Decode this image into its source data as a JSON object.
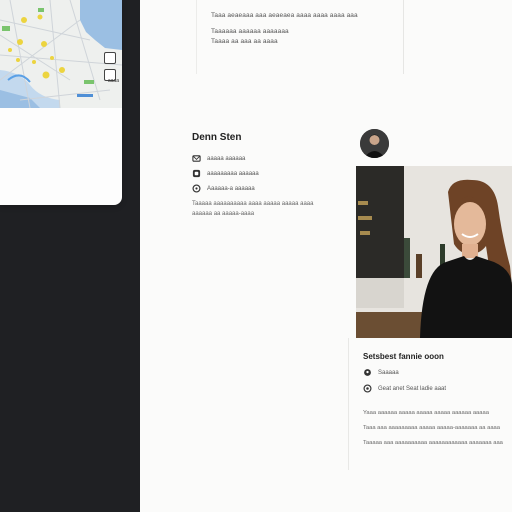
{
  "top_panel": {
    "lines": [
      "Taaa aeaeaaa aaa aeaeaea aaaa aaaa aaaa aaa",
      "Taaaaaa aaaaaa aaaaaaa",
      "Taaaa aa aaa aa aaaa"
    ]
  },
  "map": {
    "controls": [
      "layers-icon",
      "crop-icon"
    ],
    "label": "aaaa"
  },
  "profile": {
    "name": "Denn Sten",
    "rows": [
      {
        "icon": "mail-icon",
        "text": "aaaaa aaaaaa"
      },
      {
        "icon": "phone-icon",
        "text": "aaaaaaaaa aaaaaa"
      },
      {
        "icon": "location-icon",
        "text": "Aaaaaa-a aaaaaa"
      }
    ],
    "description_lines": [
      "Taaaaa aaaaaaaaaa aaaa aaaaa aaaaa aaaa",
      "aaaaaa aa aaaaa-aaaa"
    ]
  },
  "card": {
    "title": "Setsbest fannie ooon",
    "rows": [
      {
        "icon": "pin-icon",
        "text": "Saaaaa"
      },
      {
        "icon": "info-icon",
        "text": "Geat anet Seat ladie aaat"
      }
    ],
    "description_lines": [
      "Yaaa aaaaaa aaaaa aaaaa aaaaa aaaaaa aaaaa",
      "Taaa aaa aaaaaaaaa aaaaa aaaaa-aaaaaaa aa aaaa",
      "Taaaaa aaa aaaaaaaaaa aaaaaaaaaaaa aaaaaaa aaa"
    ]
  },
  "colors": {
    "rail": "#1f2023",
    "background": "#fbfbfa",
    "map_water": "#8fb7df",
    "map_pin": "#ecd43f",
    "map_green": "#7ac46d"
  }
}
